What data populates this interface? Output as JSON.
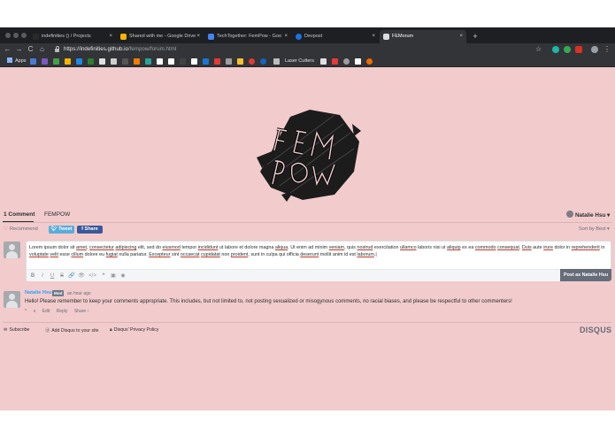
{
  "browser": {
    "tabs": [
      {
        "title": "indefinities () / Projects",
        "active": false,
        "favicon_color": "#2a2a2a"
      },
      {
        "title": "Shared with me - Google Drive",
        "active": false,
        "favicon_color": "#f4b400"
      },
      {
        "title": "TechTogether: FemPow - Goo",
        "active": false,
        "favicon_color": "#4285f4"
      },
      {
        "title": "Devpost",
        "active": false,
        "favicon_color": "#1a73e8"
      },
      {
        "title": "FEMorum",
        "active": true,
        "favicon_color": "#dddddd"
      }
    ],
    "new_tab_label": "+",
    "close_label": "×",
    "nav": {
      "back": "←",
      "forward": "→",
      "reload": "C",
      "home": "⌂"
    },
    "url": {
      "host": "https://indefinities.github.io",
      "path": "/fempow/forum.html"
    },
    "star": "☆",
    "menu": "⋮",
    "bookmarks": {
      "apps_label": "Apps",
      "folder_label": "Laser Cutters"
    }
  },
  "forum": {
    "tabs": {
      "comments": "1 Comment",
      "community": "FEMPOW"
    },
    "user_name": "Natalie Hsu",
    "user_caret": "▾",
    "recommend_label": "Recommend",
    "tweet_label": "Tweet",
    "share_label": "Share",
    "sort_label": "Sort by Best",
    "composer": {
      "text_segments": [
        {
          "t": "Lorem ipsum dolor sit ",
          "u": false
        },
        {
          "t": "amet",
          "u": true
        },
        {
          "t": ", ",
          "u": false
        },
        {
          "t": "consectetur",
          "u": true
        },
        {
          "t": " ",
          "u": false
        },
        {
          "t": "adipiscing",
          "u": true
        },
        {
          "t": " elit, sed do ",
          "u": false
        },
        {
          "t": "eiusmod",
          "u": true
        },
        {
          "t": " tempor ",
          "u": false
        },
        {
          "t": "incididunt",
          "u": true
        },
        {
          "t": " ut labore et dolore magna ",
          "u": false
        },
        {
          "t": "aliqua",
          "u": true
        },
        {
          "t": ". Ut enim ad minim ",
          "u": false
        },
        {
          "t": "veniam",
          "u": true
        },
        {
          "t": ", quis ",
          "u": false
        },
        {
          "t": "nostrud",
          "u": true
        },
        {
          "t": " exercitation ",
          "u": false
        },
        {
          "t": "ullamco",
          "u": true
        },
        {
          "t": " laboris nisi ut ",
          "u": false
        },
        {
          "t": "aliquip",
          "u": true
        },
        {
          "t": " ex ea ",
          "u": false
        },
        {
          "t": "commodo",
          "u": true
        },
        {
          "t": " ",
          "u": false
        },
        {
          "t": "consequat",
          "u": true
        },
        {
          "t": ". ",
          "u": false
        },
        {
          "t": "Duis",
          "u": true
        },
        {
          "t": " aute ",
          "u": false
        },
        {
          "t": "irure",
          "u": true
        },
        {
          "t": " dolor in ",
          "u": false
        },
        {
          "t": "reprehenderit",
          "u": true
        },
        {
          "t": " in ",
          "u": false
        },
        {
          "t": "voluptate",
          "u": true
        },
        {
          "t": " ",
          "u": false
        },
        {
          "t": "velit",
          "u": true
        },
        {
          "t": " esse ",
          "u": false
        },
        {
          "t": "cillum",
          "u": true
        },
        {
          "t": " dolore eu ",
          "u": false
        },
        {
          "t": "fugiat",
          "u": true
        },
        {
          "t": " nulla pariatur. ",
          "u": false
        },
        {
          "t": "Excepteur",
          "u": true
        },
        {
          "t": " sint ",
          "u": false
        },
        {
          "t": "occaecat",
          "u": true
        },
        {
          "t": " ",
          "u": false
        },
        {
          "t": "cupidatat",
          "u": true
        },
        {
          "t": " non ",
          "u": false
        },
        {
          "t": "proident",
          "u": true
        },
        {
          "t": ", sunt in culpa qui officia ",
          "u": false
        },
        {
          "t": "deserunt",
          "u": true
        },
        {
          "t": " mollit anim id est ",
          "u": false
        },
        {
          "t": "laborum",
          "u": true
        },
        {
          "t": ".|",
          "u": false
        }
      ],
      "toolbar_icons": [
        "B",
        "I",
        "U",
        "S",
        "🔗",
        "👁",
        "</>",
        "❝",
        "▣",
        "◉"
      ],
      "post_button": "Post as Natalie Hsu"
    },
    "comment": {
      "author": "Natalie Hsu",
      "badge": "Mod",
      "time": "an hour ago",
      "body": "Hello! Please remember to keep your comments appropriate. This includes, but not limited to, not posting sexualized or misogynous comments, no racial biases, and please be respectful to other commenters!",
      "upvote": "^",
      "downvote": "v",
      "edit": "Edit",
      "reply": "Reply",
      "share": "Share ›"
    },
    "footer": {
      "subscribe": "Subscribe",
      "add_disqus": "Add Disqus to your site",
      "privacy": "Disqus' Privacy Policy",
      "brand": "DISQUS"
    }
  }
}
